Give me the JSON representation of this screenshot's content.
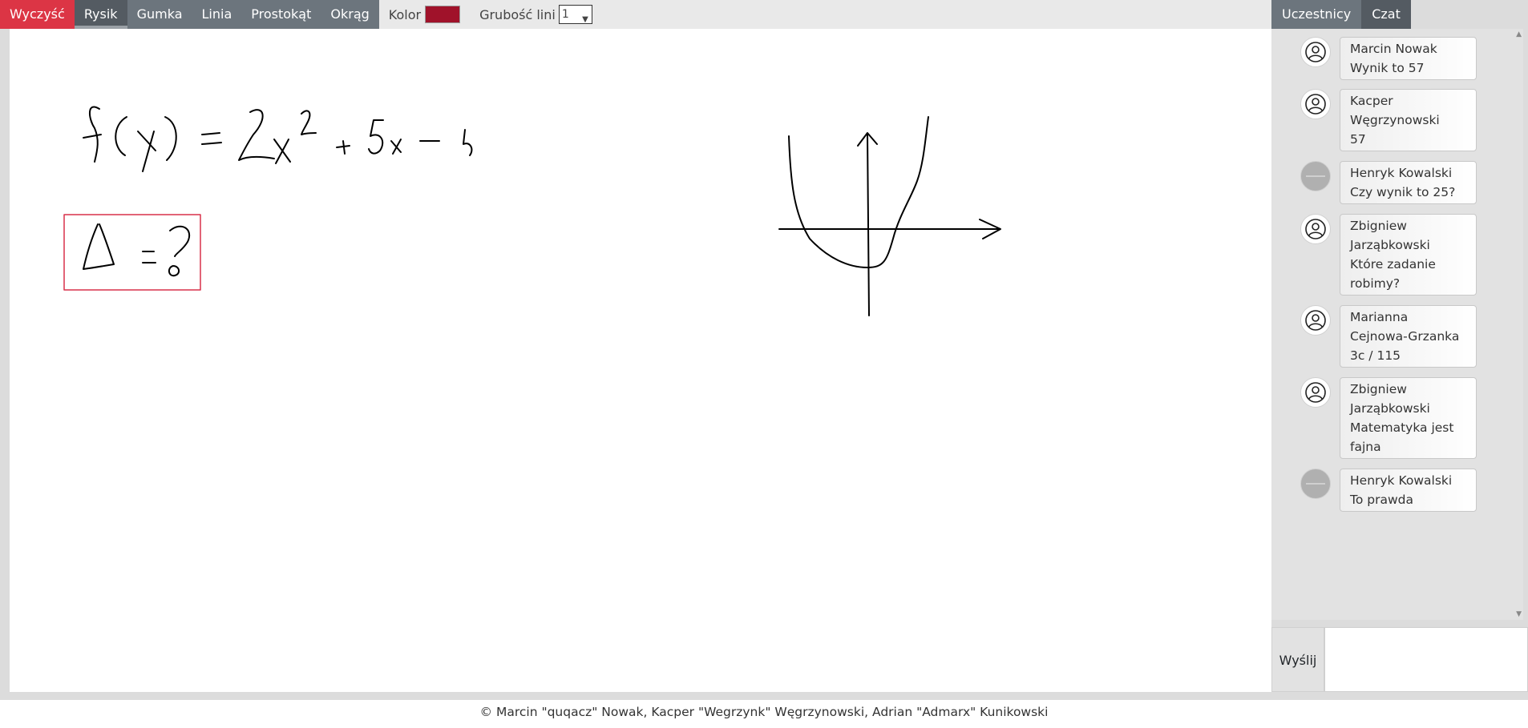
{
  "toolbar": {
    "clear": "Wyczyść",
    "pen": "Rysik",
    "eraser": "Gumka",
    "line": "Linia",
    "rectangle": "Prostokąt",
    "circle": "Okrąg",
    "color_label": "Kolor",
    "color_value": "#a0122a",
    "thickness_label": "Grubość lini",
    "thickness_value": "1"
  },
  "sidebar": {
    "tab_participants": "Uczestnicy",
    "tab_chat": "Czat"
  },
  "messages": [
    {
      "name": "Marcin Nowak",
      "text": "Wynik to 57",
      "avatar": "user-circle-icon"
    },
    {
      "name": "Kacper Węgrzynowski",
      "text": "57",
      "avatar": "user-circle-icon"
    },
    {
      "name": "Henryk Kowalski",
      "text": "Czy wynik to 25?",
      "avatar": "gray-avatar-icon"
    },
    {
      "name": "Zbigniew Jarząbkowski",
      "text": "Które zadanie robimy?",
      "avatar": "user-circle-icon"
    },
    {
      "name": "Marianna Cejnowa-Grzanka",
      "text": "3c / 115",
      "avatar": "user-circle-icon"
    },
    {
      "name": "Zbigniew Jarząbkowski",
      "text": "Matematyka jest fajna",
      "avatar": "user-circle-icon"
    },
    {
      "name": "Henryk Kowalski",
      "text": "To prawda",
      "avatar": "gray-avatar-icon"
    }
  ],
  "chat_input": {
    "send": "Wyślij",
    "value": ""
  },
  "footer": "© Marcin \"quqacz\" Nowak, Kacper \"Wegrzynk\" Węgrzynowski, Adrian \"Admarx\" Kunikowski",
  "colors": {
    "danger": "#dc3545",
    "secondary": "#6c757d",
    "rect_stroke": "#d9304a"
  }
}
